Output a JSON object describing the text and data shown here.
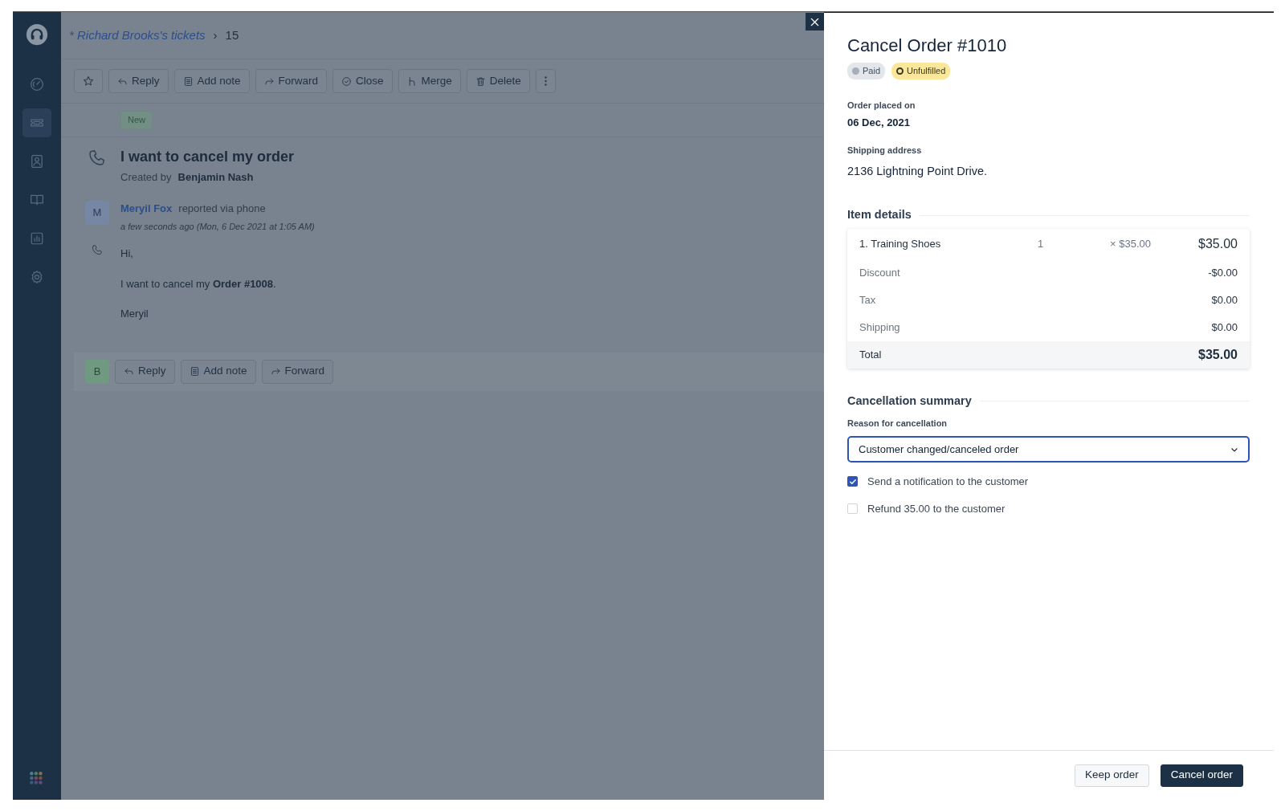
{
  "sidebar": {
    "items": [
      {
        "selected": false
      },
      {
        "selected": true
      },
      {
        "selected": false
      },
      {
        "selected": false
      },
      {
        "selected": false
      },
      {
        "selected": false
      }
    ]
  },
  "breadcrumb": {
    "parent": "* Richard Brooks's tickets",
    "separator": "›",
    "current": "15"
  },
  "toolbar": {
    "buttons": [
      "Reply",
      "Add note",
      "Forward",
      "Close",
      "Merge",
      "Delete"
    ]
  },
  "ticket": {
    "status": "New",
    "title": "I want to cancel my order",
    "created_by_label": "Created by",
    "created_by": "Benjamin Nash",
    "message": {
      "avatar": "M",
      "author": "Meryil Fox",
      "via": "reported via phone",
      "time": "a few seconds ago (Mon, 6 Dec 2021 at 1:05 AM)",
      "body": [
        "Hi,",
        "I want to cancel my **Order #1008**.",
        "Meryil"
      ]
    }
  },
  "reply_bar": {
    "avatar": "B",
    "buttons": [
      "Reply",
      "Add note",
      "Forward"
    ]
  },
  "dialog": {
    "title": "Cancel Order #1010",
    "badges": [
      {
        "label": "Paid",
        "kind": "paid"
      },
      {
        "label": "Unfulfilled",
        "kind": "unfulfilled"
      }
    ],
    "order_placed_label": "Order placed on",
    "order_date": "06 Dec, 2021",
    "shipping_label": "Shipping address",
    "address": "2136 Lightning Point Drive.",
    "item_details_title": "Item details",
    "items": [
      {
        "name": "1. Training Shoes",
        "qty": "1",
        "unit_price": "× $35.00",
        "amount": "$35.00"
      }
    ],
    "summary": [
      {
        "label": "Discount",
        "value": "-$0.00",
        "kind": "line"
      },
      {
        "label": "Tax",
        "value": "$0.00",
        "kind": "line"
      },
      {
        "label": "Shipping",
        "value": "$0.00",
        "kind": "line"
      },
      {
        "label": "Total",
        "value": "$35.00",
        "kind": "total"
      }
    ],
    "cancellation_title": "Cancellation summary",
    "reason_label": "Reason for cancellation",
    "reason": "Customer changed/canceled order",
    "options": [
      {
        "label": "Send a notification to the customer",
        "checked": true
      },
      {
        "label": "Refund 35.00 to the customer",
        "checked": false
      }
    ],
    "buttons": [
      {
        "label": "Keep order",
        "kind": "secondary"
      },
      {
        "label": "Cancel order",
        "kind": "primary"
      }
    ]
  }
}
